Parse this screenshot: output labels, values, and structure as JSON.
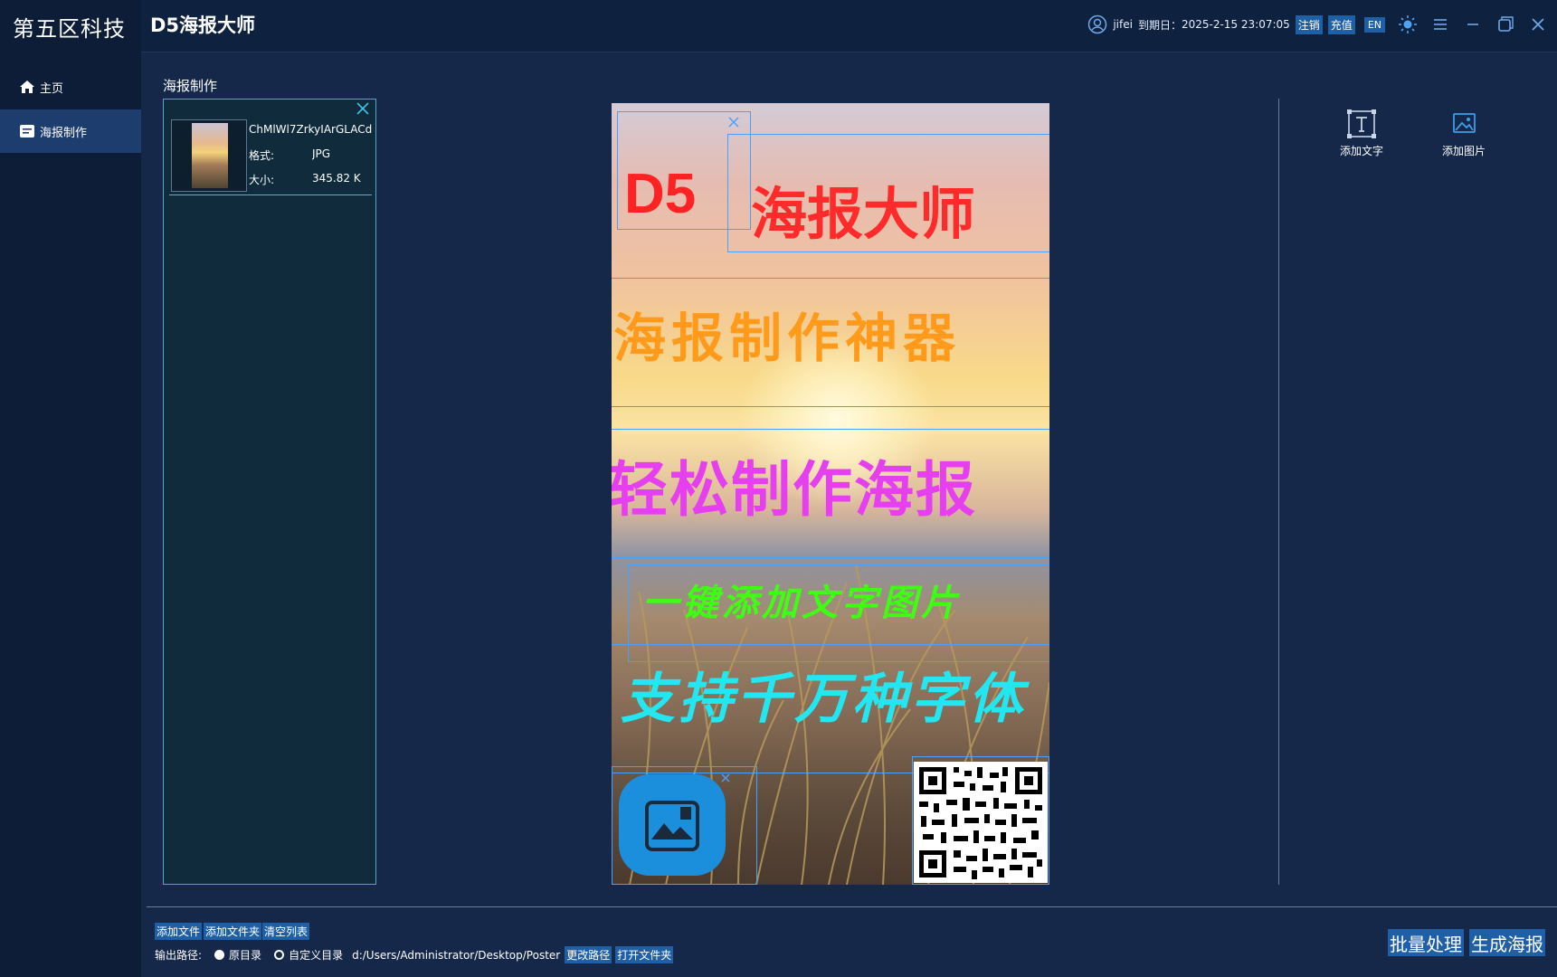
{
  "sidebar": {
    "brand": "第五区科技",
    "items": [
      {
        "label": "主页",
        "icon": "home-icon",
        "active": false
      },
      {
        "label": "海报制作",
        "icon": "poster-icon",
        "active": true
      }
    ]
  },
  "header": {
    "title": "D5海报大师",
    "user": "jifei",
    "expiry_label": "到期日：",
    "expiry": "2025-2-15 23:07:05",
    "logout_label": "注销",
    "recharge_label": "充值",
    "lang_label": "EN"
  },
  "main": {
    "section_title": "海报制作",
    "files": [
      {
        "name": "ChMlWl7ZrkyIArGLACd(",
        "format_label": "格式:",
        "format": "JPG",
        "size_label": "大小:",
        "size": "345.82 K"
      }
    ]
  },
  "poster": {
    "texts": [
      "D5",
      "海报大师",
      "海报制作神器",
      "轻松制作海报",
      "一键添加文字图片",
      "支持千万种字体"
    ],
    "colors": {
      "red": "#ff2222",
      "orange": "#ff9a1a",
      "magenta": "#e63ff0",
      "green": "#3dff12",
      "cyan": "#22e6f0"
    }
  },
  "tools": {
    "add_text": "添加文字",
    "add_image": "添加图片"
  },
  "footer": {
    "add_file": "添加文件",
    "add_folder": "添加文件夹",
    "clear_list": "清空列表",
    "output_label": "输出路径:",
    "original_dir": "原目录",
    "custom_dir": "自定义目录",
    "path": "d:/Users/Administrator/Desktop/Poster",
    "change_path": "更改路径",
    "open_folder": "打开文件夹",
    "batch": "批量处理",
    "generate": "生成海报"
  },
  "colors": {
    "accent": "#1f5fa6",
    "bg": "#15284a",
    "sidebar": "#0d1d38"
  }
}
